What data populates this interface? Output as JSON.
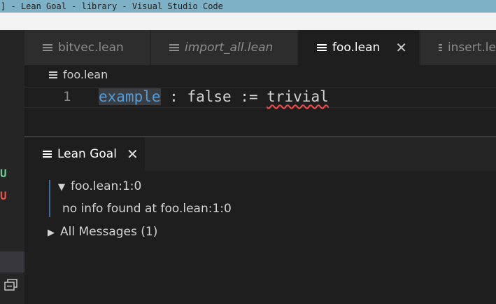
{
  "window": {
    "title": "] - Lean Goal - library - Visual Studio Code"
  },
  "tabs": [
    {
      "label": "bitvec.lean",
      "italic": false,
      "active": false
    },
    {
      "label": "import_all.lean",
      "italic": true,
      "active": false
    },
    {
      "label": "foo.lean",
      "italic": false,
      "active": true
    },
    {
      "label": "insert.le",
      "italic": false,
      "active": false
    }
  ],
  "breadcrumb": {
    "file": "foo.lean"
  },
  "editor": {
    "line_number": "1",
    "code": {
      "keyword": "example",
      "middle": " : false := ",
      "error_token": "trivial"
    }
  },
  "sidebar": {
    "scm_markers": [
      "U",
      "U"
    ]
  },
  "panel": {
    "tab_label": "Lean Goal",
    "goal_header": "foo.lean:1:0",
    "goal_body": "no info found at foo.lean:1:0",
    "messages_label": "All Messages (1)"
  },
  "icons": {
    "file": "lines-icon",
    "close": "close-icon",
    "collapse": "chevron-down-icon",
    "expand": "chevron-right-icon"
  },
  "colors": {
    "keyword": "#569cd6",
    "error": "#f14c4c",
    "scm_untracked_green": "#73c991",
    "scm_untracked_red": "#e2564f"
  }
}
